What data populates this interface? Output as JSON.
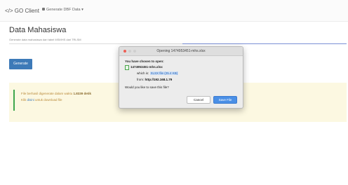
{
  "nav": {
    "brand": "</> GO Client",
    "menu_label": "Generate DBF Data ▾"
  },
  "page": {
    "title": "Data Mahasiswa",
    "subtitle": "Generate data mahasiswa dari tabel MSMHS dari TRLSM",
    "generate_label": "Generate"
  },
  "alert": {
    "line1_prefix": "File berhasil digenerate dalam waktu ",
    "duration": "1.8339 detik",
    "line2_prefix": "Klik ",
    "link": "disini",
    "line2_suffix": " untuk download file"
  },
  "dialog": {
    "title": "Opening 1474953451-mhs.xlsx",
    "prompt": "You have chosen to open:",
    "filename": "1474953451-mhs.xlsx",
    "which_is_label": "which is: ",
    "file_type": "XLSX file (25.4 KB)",
    "from_label": "from: ",
    "from_url": "http://192.168.1.79",
    "save_question": "Would you like to save this file?",
    "cancel_label": "Cancel",
    "save_label": "Save File",
    "colors": {
      "close": "#ee5e55",
      "min": "#cfcfcf",
      "max": "#cfcfcf"
    }
  }
}
